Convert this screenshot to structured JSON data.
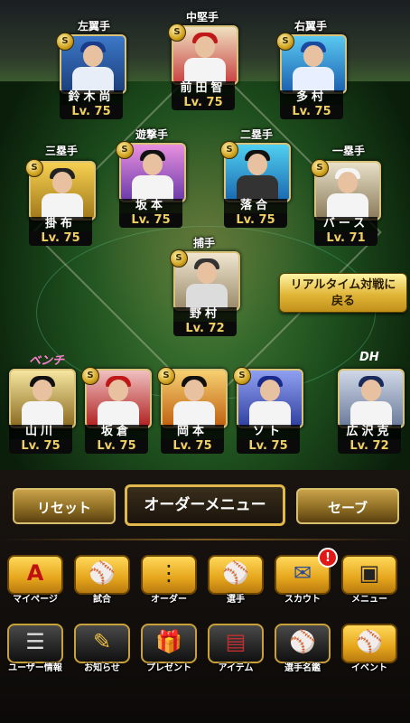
{
  "positions": {
    "lf": "左翼手",
    "cf": "中堅手",
    "rf": "右翼手",
    "3b": "三塁手",
    "ss": "遊撃手",
    "2b": "二塁手",
    "1b": "一塁手",
    "c": "捕手",
    "bench": "ベンチ",
    "dh": "DH"
  },
  "players": {
    "lf": {
      "name": "鈴木尚",
      "level": "Lv. 75"
    },
    "cf": {
      "name": "前田智",
      "level": "Lv. 75"
    },
    "rf": {
      "name": "多村",
      "level": "Lv. 75"
    },
    "3b": {
      "name": "掛布",
      "level": "Lv. 75"
    },
    "ss": {
      "name": "坂本",
      "level": "Lv. 75"
    },
    "2b": {
      "name": "落合",
      "level": "Lv. 75"
    },
    "1b": {
      "name": "バース",
      "level": "Lv. 71"
    },
    "c": {
      "name": "野村",
      "level": "Lv. 72"
    },
    "bench1": {
      "name": "山川",
      "level": "Lv. 75"
    },
    "bench2": {
      "name": "坂倉",
      "level": "Lv. 75"
    },
    "bench3": {
      "name": "岡本",
      "level": "Lv. 75"
    },
    "bench4": {
      "name": "ソト",
      "level": "Lv. 75"
    },
    "dh": {
      "name": "広沢克",
      "level": "Lv. 72"
    }
  },
  "badge": "S",
  "realtime_button": {
    "line1": "リアルタイム対戦に",
    "line2": "戻る"
  },
  "actions": {
    "reset": "リセット",
    "order_menu": "オーダーメニュー",
    "save": "セーブ"
  },
  "menu_row1": [
    "マイページ",
    "試合",
    "オーダー",
    "選手",
    "スカウト",
    "メニュー"
  ],
  "menu_row2": [
    "ユーザー情報",
    "お知らせ",
    "プレゼント",
    "アイテム",
    "選手名鑑",
    "イベント"
  ],
  "notification_badge": "!",
  "icons": {
    "mypage": "A",
    "match": "⚾",
    "order": "⋮",
    "player": "⚾",
    "scout": "✉",
    "menu": "▣",
    "user": "☰",
    "news": "✎",
    "present": "🎁",
    "item": "▤",
    "directory": "⚾",
    "event": "⚾"
  },
  "colors": {
    "accent_gold": "#e0b84c",
    "level_text": "#f0d060",
    "alert": "#e01818"
  }
}
